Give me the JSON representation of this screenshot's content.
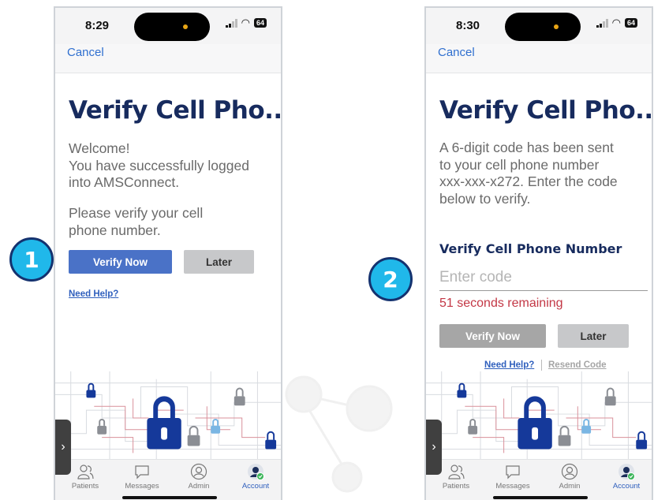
{
  "screen1": {
    "status": {
      "time": "8:29",
      "battery": "64"
    },
    "cancel": "Cancel",
    "title": "Verify Cell Pho...",
    "welcome_lines": [
      "Welcome!",
      "You have successfully logged",
      "into AMSConnect."
    ],
    "verify_prompt_lines": [
      "Please verify your cell",
      "phone number."
    ],
    "verify_button": "Verify Now",
    "later_button": "Later",
    "need_help": "Need Help?"
  },
  "screen2": {
    "status": {
      "time": "8:30",
      "battery": "64"
    },
    "cancel": "Cancel",
    "title": "Verify Cell Pho...",
    "message_lines": [
      "A 6-digit code has been sent",
      "to your cell phone number",
      "xxx-xxx-x272. Enter the code",
      "below to verify."
    ],
    "field_label": "Verify Cell Phone Number",
    "code_placeholder": "Enter code",
    "countdown": "51 seconds remaining",
    "verify_button": "Verify Now",
    "later_button": "Later",
    "need_help": "Need Help?",
    "resend_code": "Resend Code"
  },
  "tabbar": {
    "tabs": [
      {
        "label": "Patients",
        "icon": "patients-icon"
      },
      {
        "label": "Messages",
        "icon": "messages-icon"
      },
      {
        "label": "Admin",
        "icon": "admin-icon"
      },
      {
        "label": "Account",
        "icon": "account-icon"
      }
    ],
    "active": "Account"
  },
  "callouts": {
    "step1": "1",
    "step2": "2"
  },
  "side_handle": "›",
  "colors": {
    "title_navy": "#172b5e",
    "primary_button": "#4a72c7",
    "link_blue": "#2f6fcf",
    "countdown_red": "#c33745",
    "callout_cyan": "#20b8ea"
  }
}
